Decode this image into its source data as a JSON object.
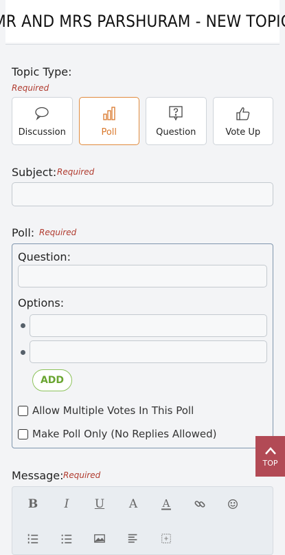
{
  "header": {
    "title": "MR AND MRS PARSHURAM - NEW TOPIC"
  },
  "topic_type": {
    "label": "Topic Type:",
    "required": "Required",
    "options": [
      {
        "label": "Discussion",
        "icon": "speech-bubble-icon"
      },
      {
        "label": "Poll",
        "icon": "bar-chart-icon",
        "selected": true
      },
      {
        "label": "Question",
        "icon": "question-bubble-icon"
      },
      {
        "label": "Vote Up",
        "icon": "thumbs-up-icon"
      }
    ]
  },
  "subject": {
    "label": "Subject:",
    "required": "Required",
    "value": ""
  },
  "poll": {
    "label": "Poll:",
    "required": "Required",
    "question_label": "Question:",
    "question_value": "",
    "options_label": "Options:",
    "options": [
      "",
      ""
    ],
    "add_label": "ADD",
    "allow_multiple_label": "Allow Multiple Votes In This Poll",
    "poll_only_label": "Make Poll Only (No Replies Allowed)"
  },
  "message": {
    "label": "Message:",
    "required": "Required"
  },
  "top_button": {
    "label": "TOP"
  },
  "editor_toolbar": {
    "row1": [
      "bold-icon",
      "italic-icon",
      "underline-icon",
      "font-size-icon",
      "font-color-icon",
      "link-icon",
      "emoji-icon"
    ],
    "row2": [
      "numbered-list-icon",
      "bulleted-list-icon",
      "image-icon",
      "align-left-icon",
      "insert-icon"
    ]
  },
  "colors": {
    "accent": "#e08a3c",
    "required": "#b03a2e",
    "add": "#6aa531",
    "top": "#b24a55"
  }
}
